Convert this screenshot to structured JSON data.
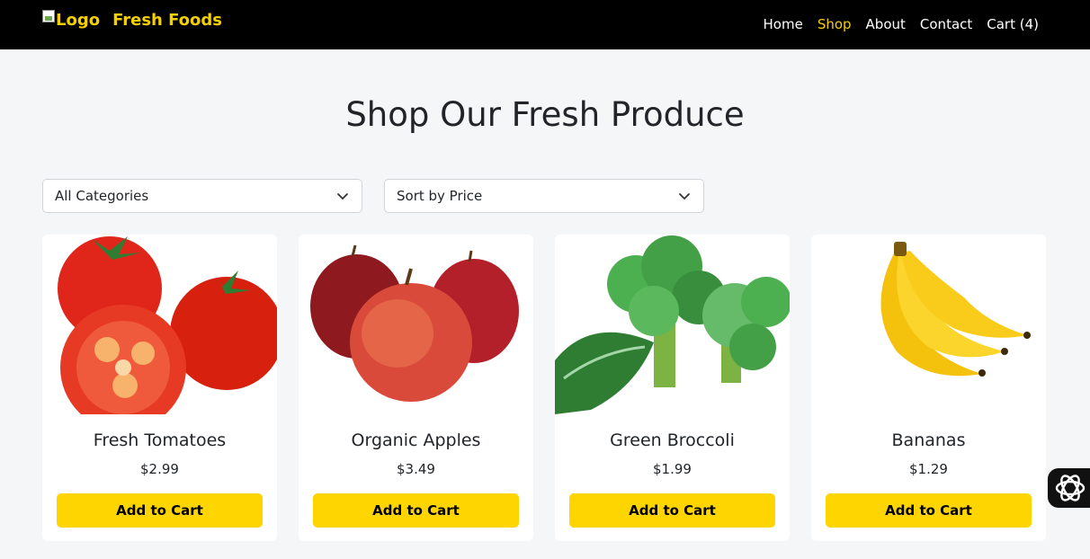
{
  "nav": {
    "logo_alt": "Logo",
    "brand": "Fresh Foods",
    "links": [
      {
        "label": "Home"
      },
      {
        "label": "Shop"
      },
      {
        "label": "About"
      },
      {
        "label": "Contact"
      },
      {
        "label": "Cart (4)"
      }
    ],
    "active": "Shop"
  },
  "page": {
    "title": "Shop Our Fresh Produce"
  },
  "filters": {
    "category": {
      "selected": "All Categories"
    },
    "sort": {
      "selected": "Sort by Price"
    }
  },
  "products": [
    {
      "name": "Fresh Tomatoes",
      "price": "$2.99",
      "button": "Add to Cart"
    },
    {
      "name": "Organic Apples",
      "price": "$3.49",
      "button": "Add to Cart"
    },
    {
      "name": "Green Broccoli",
      "price": "$1.99",
      "button": "Add to Cart"
    },
    {
      "name": "Bananas",
      "price": "$1.29",
      "button": "Add to Cart"
    }
  ],
  "colors": {
    "accent": "#ffd500",
    "navbar": "#000000",
    "background": "#f5f6f8"
  }
}
